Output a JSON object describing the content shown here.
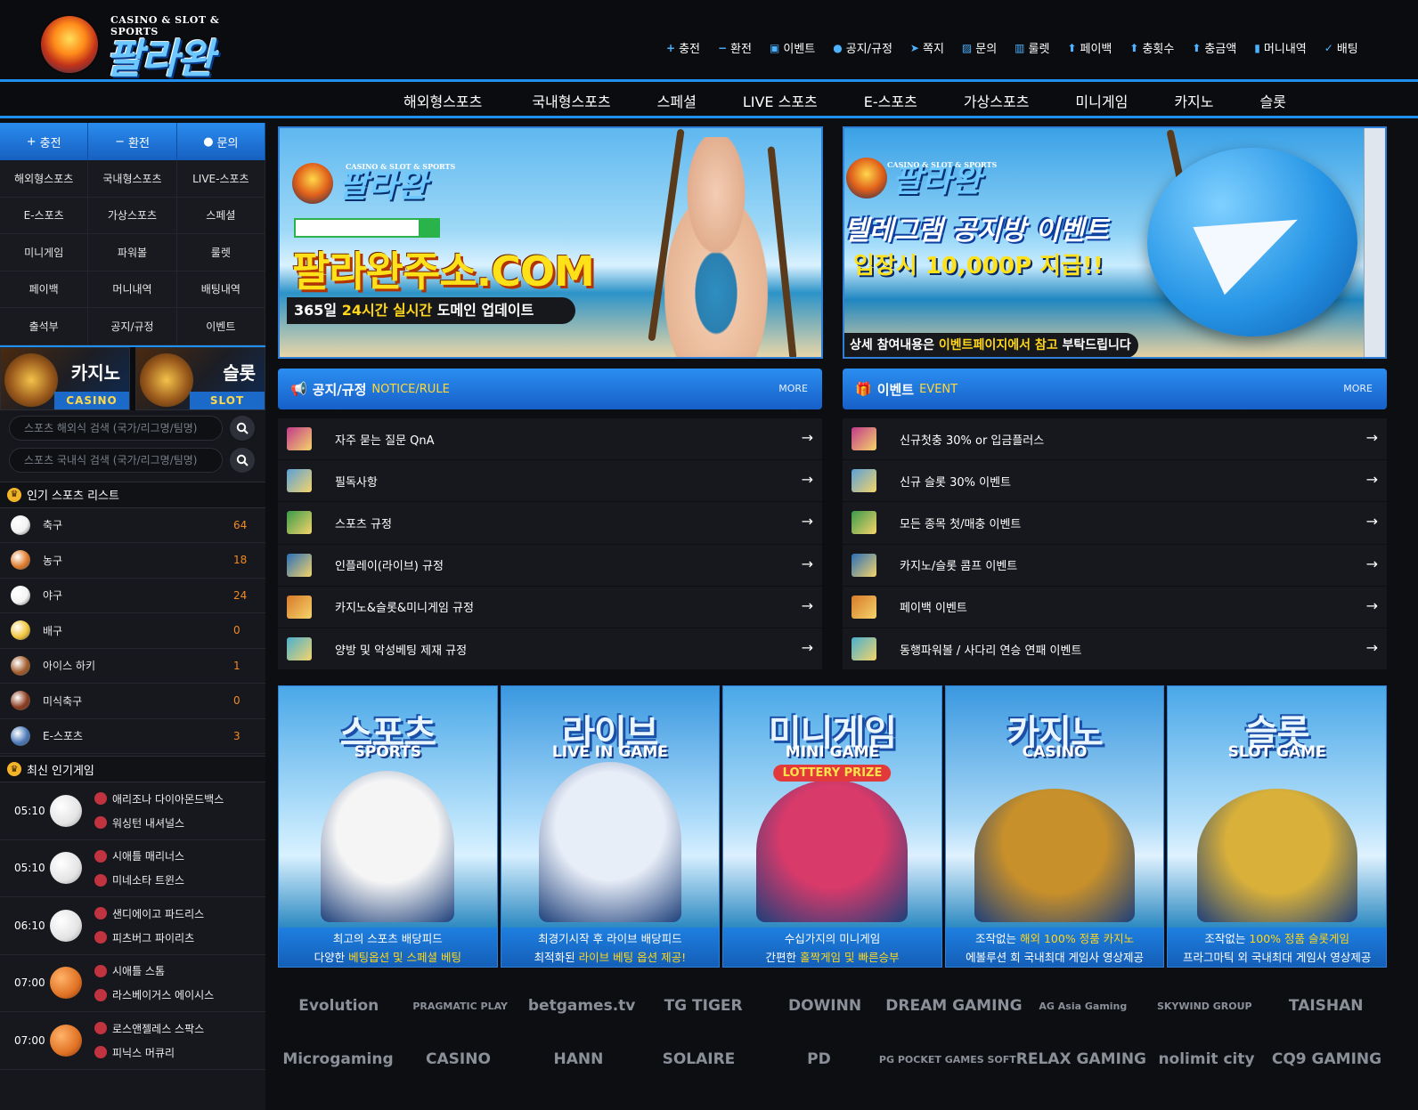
{
  "logo": {
    "sub": "CASINO & SLOT & SPORTS",
    "title": "팔라완"
  },
  "topnav": [
    {
      "icon": "+",
      "label": "충전"
    },
    {
      "icon": "−",
      "label": "환전"
    },
    {
      "icon": "▣",
      "label": "이벤트"
    },
    {
      "icon": "●",
      "label": "공지/규정"
    },
    {
      "icon": "➤",
      "label": "쪽지"
    },
    {
      "icon": "▨",
      "label": "문의"
    },
    {
      "icon": "▥",
      "label": "룰렛"
    },
    {
      "icon": "⬆",
      "label": "페이백"
    },
    {
      "icon": "⬆",
      "label": "충횟수"
    },
    {
      "icon": "⬆",
      "label": "충금액"
    },
    {
      "icon": "▮",
      "label": "머니내역"
    },
    {
      "icon": "✓",
      "label": "배팅"
    }
  ],
  "mainnav": [
    "해외형스포츠",
    "국내형스포츠",
    "스페셜",
    "LIVE 스포츠",
    "E-스포츠",
    "가상스포츠",
    "미니게임",
    "카지노",
    "슬롯"
  ],
  "sidebar": {
    "quick": [
      {
        "icon": "+",
        "label": "충전"
      },
      {
        "icon": "−",
        "label": "환전"
      },
      {
        "icon": "●",
        "label": "문의"
      }
    ],
    "grid": [
      "해외형스포츠",
      "국내형스포츠",
      "LIVE-스포츠",
      "E-스포츠",
      "가상스포츠",
      "스페셜",
      "미니게임",
      "파워볼",
      "룰렛",
      "페이백",
      "머니내역",
      "배팅내역",
      "출석부",
      "공지/규정",
      "이벤트"
    ],
    "casino": {
      "title": "카지노",
      "en": "CASINO"
    },
    "slot": {
      "title": "슬롯",
      "en": "SLOT"
    },
    "search_overseas": "스포츠 해외식 검색 (국가/리그명/팀명)",
    "search_domestic": "스포츠 국내식 검색 (국가/리그명/팀명)",
    "popular_title": "인기 스포츠 리스트",
    "sports": [
      {
        "name": "축구",
        "count": "64",
        "color": "#f2f2f2"
      },
      {
        "name": "농구",
        "count": "18",
        "color": "#e07a2a"
      },
      {
        "name": "야구",
        "count": "24",
        "color": "#f4f4f4"
      },
      {
        "name": "배구",
        "count": "0",
        "color": "#f0c53a"
      },
      {
        "name": "아이스 하키",
        "count": "1",
        "color": "#a05a2a"
      },
      {
        "name": "미식축구",
        "count": "0",
        "color": "#8a3a1c"
      },
      {
        "name": "E-스포츠",
        "count": "3",
        "color": "#4a78b8"
      }
    ],
    "hot_title": "최신 인기게임",
    "hot_games": [
      {
        "time": "05:10",
        "ball": "baseball",
        "home": "애리조나 다이아몬드백스",
        "away": "워싱턴 내셔널스"
      },
      {
        "time": "05:10",
        "ball": "baseball",
        "home": "시애틀 매리너스",
        "away": "미네소타 트윈스"
      },
      {
        "time": "06:10",
        "ball": "baseball",
        "home": "샌디에이고 파드리스",
        "away": "피츠버그 파이리츠"
      },
      {
        "time": "07:00",
        "ball": "basketball",
        "home": "시애틀 스톰",
        "away": "라스베이거스 에이시스"
      },
      {
        "time": "07:00",
        "ball": "basketball",
        "home": "로스앤젤레스 스팍스",
        "away": "피닉스 머큐리"
      }
    ]
  },
  "banner1": {
    "sub": "CASINO & SLOT & SPORTS",
    "logo": "팔라완",
    "url": "팔라완주소.COM",
    "cap_a": "365일 ",
    "cap_b": "24시간 실시간",
    "cap_c": " 도메인 업데이트"
  },
  "banner2": {
    "sub": "CASINO & SLOT & SPORTS",
    "logo": "팔라완",
    "line1": "텔레그램 공지방 이벤트",
    "line2": "입장시 10,000P 지급!!",
    "cap_a": "상세 참여내용은 ",
    "cap_b": "이벤트페이지에서 참고",
    "cap_c": " 부탁드립니다"
  },
  "notice": {
    "title": "공지/규정",
    "en": "NOTICE/RULE",
    "more": "MORE",
    "items": [
      "자주 묻는 질문 QnA",
      "필독사항",
      "스포츠 규정",
      "인플레이(라이브) 규정",
      "카지노&슬롯&미니게임 규정",
      "양방 및 악성베팅 제재 규정"
    ]
  },
  "event": {
    "title": "이벤트",
    "en": "EVENT",
    "more": "MORE",
    "items": [
      "신규첫충 30% or 입금플러스",
      "신규 슬롯 30% 이벤트",
      "모든 종목 첫/매충 이벤트",
      "카지노/슬롯 콤프 이벤트",
      "페이백 이벤트",
      "동행파워볼 / 사다리 연승 연패 이벤트"
    ]
  },
  "cards": [
    {
      "kr": "스포츠",
      "en": "SPORTS",
      "l1": "최고의 스포츠 배당피드",
      "l2a": "다양한 ",
      "l2b": "베팅옵션 및 스페셜 베팅",
      "l2c": "",
      "l1y": ""
    },
    {
      "kr": "라이브",
      "en": "LIVE IN GAME",
      "l1": "최경기시작 후 라이브 배당피드",
      "l2a": "최적화된 ",
      "l2b": "라이브 베팅 옵션 제공!",
      "l2c": "",
      "l1y": ""
    },
    {
      "kr": "미니게임",
      "en": "MINI GAME",
      "l1": "수십가지의 미니게임",
      "l2a": "간편한 ",
      "l2b": "홀짝게임 및 빠른승부",
      "l2c": "",
      "l1y": "",
      "extra": "LOTTERY PRIZE"
    },
    {
      "kr": "카지노",
      "en": "CASINO",
      "l1": "조작없는 ",
      "l1y": "해외 100% 정품 카지노",
      "l2a": "에볼루션 회 국내최대 게임사 영상제공",
      "l2b": "",
      "l2c": ""
    },
    {
      "kr": "슬롯",
      "en": "SLOT GAME",
      "l1": "조작없는 ",
      "l1y": "100% 정품 슬롯게임",
      "l2a": "프라그마틱 외 국내최대 게임사 영상제공",
      "l2b": "",
      "l2c": ""
    }
  ],
  "providers_row1": [
    "Evolution",
    "PRAGMATIC PLAY",
    "betgames.tv",
    "TG TIGER",
    "DOWINN",
    "DREAM GAMING",
    "AG Asia Gaming",
    "SKYWIND GROUP",
    "TAISHAN"
  ],
  "providers_row2": [
    "Microgaming",
    "CASINO",
    "HANN",
    "SOLAIRE",
    "PD",
    "PG POCKET GAMES SOFT",
    "RELAX GAMING",
    "nolimit city",
    "CQ9 GAMING"
  ]
}
